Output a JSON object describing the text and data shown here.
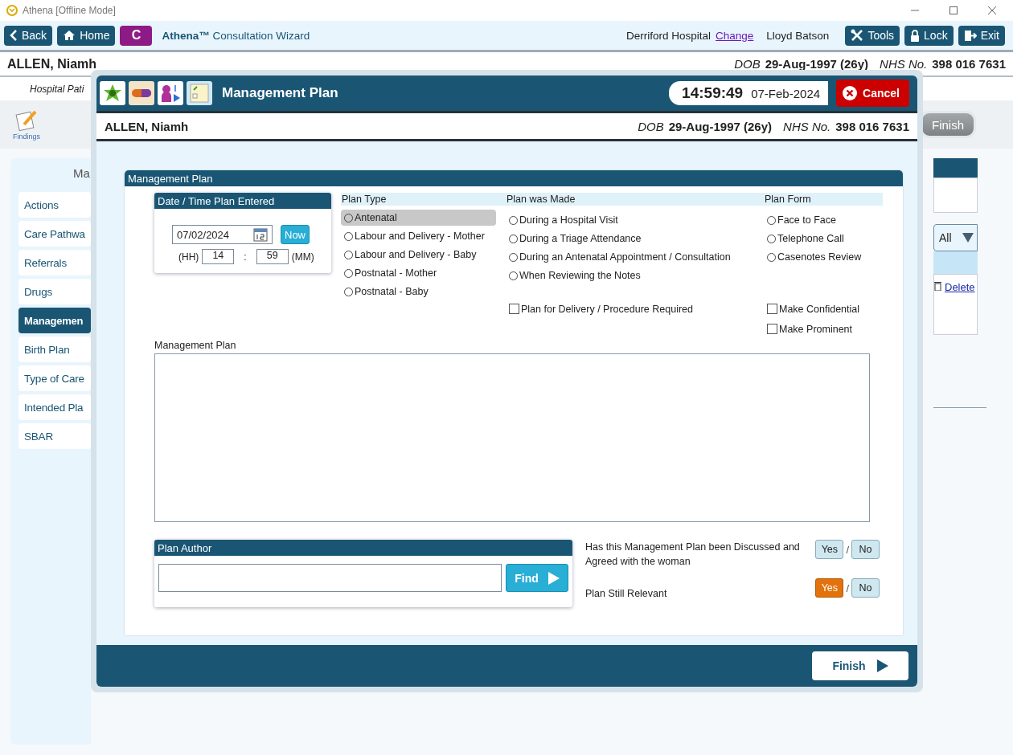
{
  "window": {
    "title": "Athena [Offline Mode]"
  },
  "toolbar": {
    "back": "Back",
    "home": "Home",
    "badge": "C",
    "app_title": "**Athena™** Consultation Wizard",
    "hospital": "Derriford Hospital",
    "change": "Change",
    "user": "Lloyd Batson",
    "tools": "Tools",
    "lock": "Lock",
    "exit": "Exit"
  },
  "patient": {
    "name": "ALLEN, Niamh",
    "dob_label": "DOB",
    "dob": "29-Aug-1997 (26y)",
    "nhs_label": "NHS No.",
    "nhs": "398 016 7631"
  },
  "subheader": "Hospital Pati",
  "findings": "Findings",
  "finish_background": {
    "label": "Finish",
    "disabled": true
  },
  "section_heading": "Ma",
  "sidebar": {
    "items": [
      {
        "label": "Actions",
        "selected": false
      },
      {
        "label": "Care Pathwa",
        "selected": false
      },
      {
        "label": "Referrals",
        "selected": false
      },
      {
        "label": "Drugs",
        "selected": false
      },
      {
        "label": "Managemen",
        "selected": true
      },
      {
        "label": "Birth Plan",
        "selected": false
      },
      {
        "label": "Type of Care",
        "selected": false
      },
      {
        "label": "Intended Pla",
        "selected": false
      },
      {
        "label": "SBAR",
        "selected": false
      }
    ]
  },
  "right_panel": {
    "filter": "All",
    "delete": "Delete"
  },
  "dialog": {
    "title": "Management Plan",
    "time": "14:59:49",
    "date": "07-Feb-2024",
    "cancel": "Cancel",
    "patient": {
      "name": "ALLEN, Niamh",
      "dob_label": "DOB",
      "dob": "29-Aug-1997 (26y)",
      "nhs_label": "NHS No.",
      "nhs": "398 016 7631"
    },
    "panel_title": "Management Plan",
    "datetime": {
      "title": "Date / Time Plan Entered",
      "date": "07/02/2024",
      "now": "Now",
      "hh_label": "(HH)",
      "hour": "14",
      "separator": ":",
      "minute": "59",
      "mm_label": "(MM)"
    },
    "plan_type": {
      "header": "Plan Type",
      "options": [
        {
          "label": "Antenatal",
          "selected": false,
          "highlighted": true
        },
        {
          "label": "Labour and Delivery - Mother",
          "selected": false,
          "highlighted": false
        },
        {
          "label": "Labour and Delivery - Baby",
          "selected": false,
          "highlighted": false
        },
        {
          "label": "Postnatal - Mother",
          "selected": false,
          "highlighted": false
        },
        {
          "label": "Postnatal - Baby",
          "selected": false,
          "highlighted": false
        }
      ]
    },
    "plan_made": {
      "header": "Plan was Made",
      "options": [
        {
          "label": "During a Hospital Visit",
          "selected": false
        },
        {
          "label": "During a Triage Attendance",
          "selected": false
        },
        {
          "label": "During an Antenatal Appointment / Consultation",
          "selected": false
        },
        {
          "label": "When Reviewing the Notes",
          "selected": false
        }
      ],
      "checkboxes": [
        {
          "label": "Plan for Delivery / Procedure Required",
          "checked": false
        }
      ]
    },
    "plan_form": {
      "header": "Plan Form",
      "options": [
        {
          "label": "Face to Face",
          "selected": false
        },
        {
          "label": "Telephone Call",
          "selected": false
        },
        {
          "label": "Casenotes Review",
          "selected": false
        }
      ],
      "checkboxes": [
        {
          "label": "Make Confidential",
          "checked": false
        },
        {
          "label": "Make Prominent",
          "checked": false
        }
      ]
    },
    "plan_label": "Management Plan",
    "author": {
      "title": "Plan Author",
      "find": "Find"
    },
    "questions": [
      {
        "text": "Has this Management Plan been Discussed and Agreed with the woman",
        "answers": [
          {
            "label": "Yes",
            "selected": false
          },
          {
            "label": "No",
            "selected": false
          }
        ],
        "separator": "/"
      },
      {
        "text": "Plan Still Relevant",
        "answers": [
          {
            "label": "Yes",
            "selected": true
          },
          {
            "label": "No",
            "selected": false
          }
        ],
        "separator": "/"
      }
    ],
    "finish": "Finish"
  }
}
